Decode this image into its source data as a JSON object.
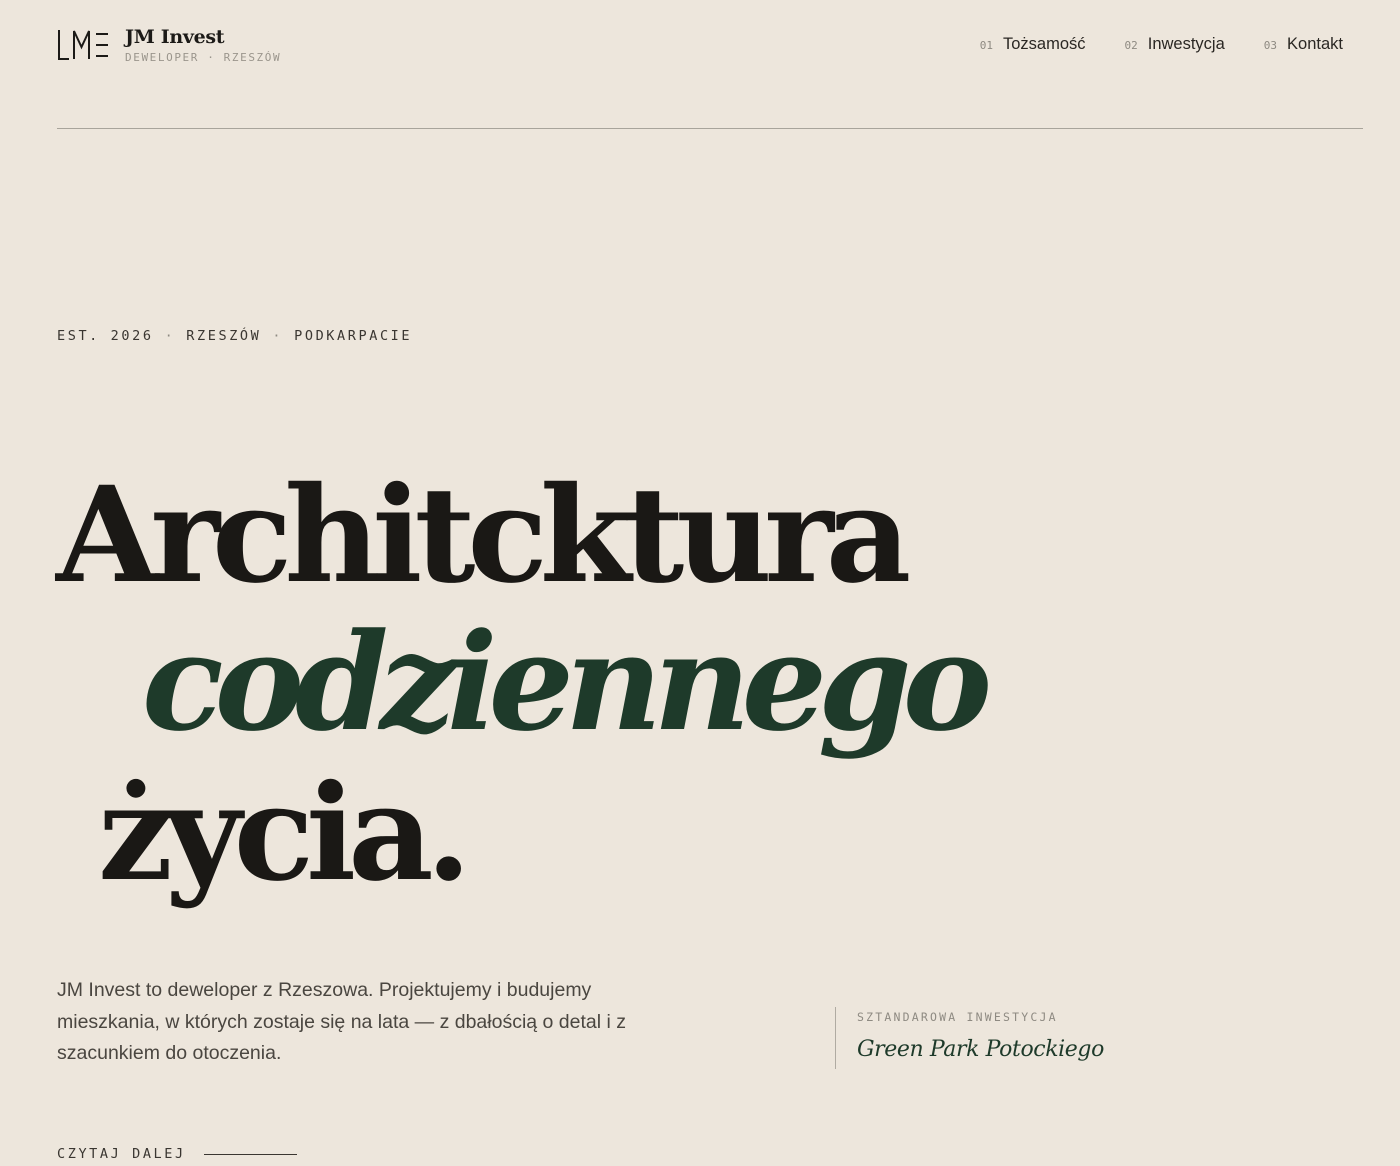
{
  "brand": {
    "logo_mark": "LME",
    "name": "JM Invest",
    "tagline": "DEWELOPER · RZESZÓW"
  },
  "nav": [
    {
      "num": "01",
      "label": "Tożsamość"
    },
    {
      "num": "02",
      "label": "Inwestycja"
    },
    {
      "num": "03",
      "label": "Kontakt"
    }
  ],
  "hero": {
    "eyebrow": [
      "EST. 2026",
      "RZESZÓW",
      "PODKARPACIE"
    ],
    "eyebrow_separator": "·",
    "headline": [
      "Architcktura",
      "codziennego",
      "życia."
    ],
    "intro": "JM Invest to deweloper z Rzeszowa. Projektujemy i budujemy mieszkania, w których zostaje się na lata — z dbałością o detal i z szacunkiem do otoczenia."
  },
  "feature": {
    "label": "SZTANDAROWA INWESTYCJA",
    "name": "Green Park Potockiego"
  },
  "readmore": {
    "label": "CZYTAJ DALEJ"
  },
  "colors": {
    "background": "#ede6dc",
    "ink": "#1a1815",
    "accent_green": "#1e3a2a",
    "muted": "#8e8a82"
  }
}
